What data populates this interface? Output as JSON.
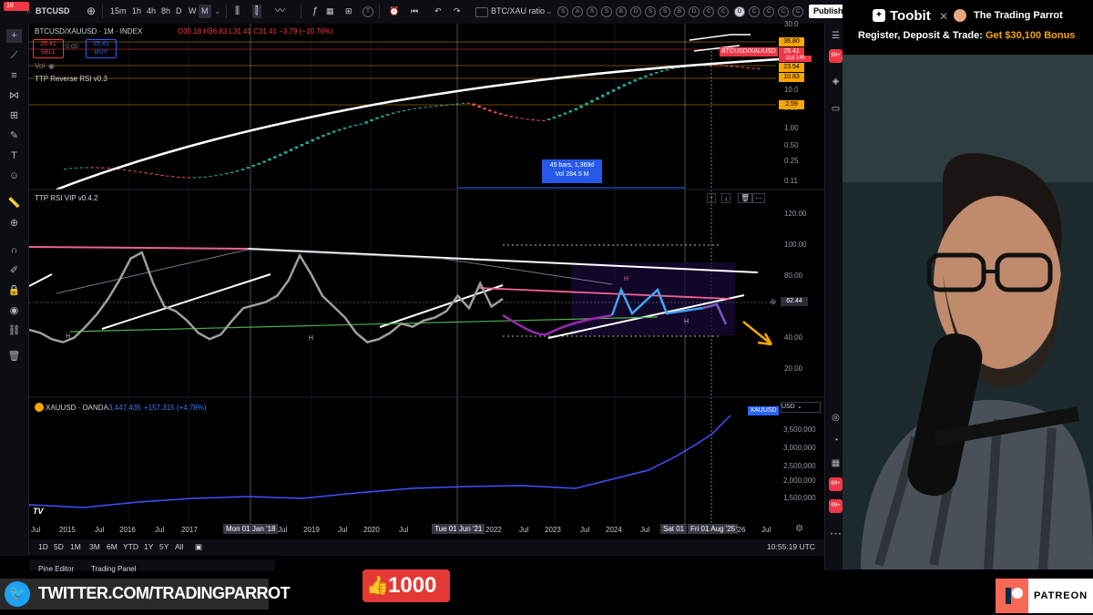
{
  "toolbar": {
    "symbol": "BTCUSD",
    "intervals": [
      "15m",
      "1h",
      "4h",
      "8h",
      "D",
      "W",
      "M"
    ],
    "active_interval": "M",
    "compare_label": "BTC/XAU ratio",
    "publish_label": "Publish",
    "badge_count": "18",
    "circle_labels": [
      "S",
      "A",
      "S",
      "S",
      "B",
      "D",
      "S",
      "S",
      "B",
      "D",
      "C",
      "C"
    ]
  },
  "main_pane": {
    "legend_title": "BTCUSD/XAUUSD · 1M · INDEX",
    "ohlc": "O35.18 H36.83 L31.41 C31.41 −3.79 (−10.76%)",
    "sell_price": "25.41",
    "sell_label": "SELL",
    "spread": "0.00",
    "buy_price": "25.41",
    "buy_label": "BUY",
    "vol_label": "Vol",
    "indicator_label": "TTP Reverse RSI v0.3",
    "y_labels": [
      "30.0",
      "10.0",
      "5.00",
      "1.00",
      "0.50",
      "0.25",
      "0.11"
    ],
    "tags": [
      {
        "text": "36.80",
        "color": "#f7a600"
      },
      {
        "text": "25.41",
        "color": "#f23645"
      },
      {
        "text": "23.54",
        "color": "#f7a600"
      },
      {
        "text": "10.83",
        "color": "#f7a600"
      },
      {
        "text": "2.59",
        "color": "#f7a600"
      }
    ],
    "symbol_tag": "BTCUSD/XAUUSD",
    "countdown": "11d 14h",
    "measure_bars": "45 bars, 1,369d",
    "measure_vol": "Vol 284.5 M"
  },
  "rsi_pane": {
    "title": "TTP RSI VIP v0.4.2",
    "y_labels": [
      "120.00",
      "100.00",
      "80.00",
      "62.44",
      "40.00",
      "20.00"
    ],
    "current_value": "62.44",
    "pivot_labels": [
      "H",
      "H",
      "H",
      "H"
    ],
    "rsi_series": [
      40,
      38,
      34,
      32,
      35,
      42,
      50,
      60,
      72,
      86,
      90,
      70,
      55,
      52,
      46,
      38,
      34,
      37,
      46,
      54,
      56,
      58,
      62,
      72,
      88,
      76,
      62,
      55,
      48,
      38,
      32,
      34,
      38,
      44,
      42,
      46,
      48,
      52,
      62,
      54,
      70,
      55,
      60
    ]
  },
  "xau_pane": {
    "title": "XAUUSD · OANDA",
    "value": "3,447.435",
    "change": "+157.315 (+4.78%)",
    "tag": "XAUUSD",
    "currency": "USD",
    "y_labels": [
      "3,500,000",
      "3,000,000",
      "2,500,000",
      "2,000,000",
      "1,500,000"
    ]
  },
  "x_axis": {
    "ticks": [
      "Jul",
      "2015",
      "Jul",
      "2016",
      "Jul",
      "2017",
      "Jul",
      "2019",
      "Jul",
      "2020",
      "Jul",
      "Jul",
      "2022",
      "Jul",
      "2023",
      "Jul",
      "2024",
      "Jul",
      "Jul",
      "'26",
      "Jul"
    ],
    "crosshair_labels": [
      "Mon 01 Jan '18",
      "Tue 01 Jun '21",
      "Sat 01",
      "Fri 01 Aug '25"
    ]
  },
  "bottom_toolbar": {
    "ranges": [
      "1D",
      "5D",
      "1M",
      "3M",
      "6M",
      "YTD",
      "1Y",
      "5Y",
      "All"
    ],
    "time": "10:55:19 UTC",
    "tabs": [
      "Pine Editor",
      "Trading Panel"
    ]
  },
  "sponsor": {
    "brand": "Toobit",
    "partner": "The Trading Parrot",
    "promo_prefix": "Register, Deposit & Trade: ",
    "promo_highlight": "Get $30,100 Bonus"
  },
  "overlays": {
    "twitter": "TWITTER.COM/TRADINGPARROT",
    "likes": "1000",
    "patreon": "PATREON"
  },
  "right_badges": [
    "99+",
    "99+",
    "99+"
  ],
  "colors": {
    "accent_blue": "#2962ff",
    "up": "#26a69a",
    "down": "#ef5350",
    "orange": "#f7a600",
    "pink": "#e91e63"
  }
}
